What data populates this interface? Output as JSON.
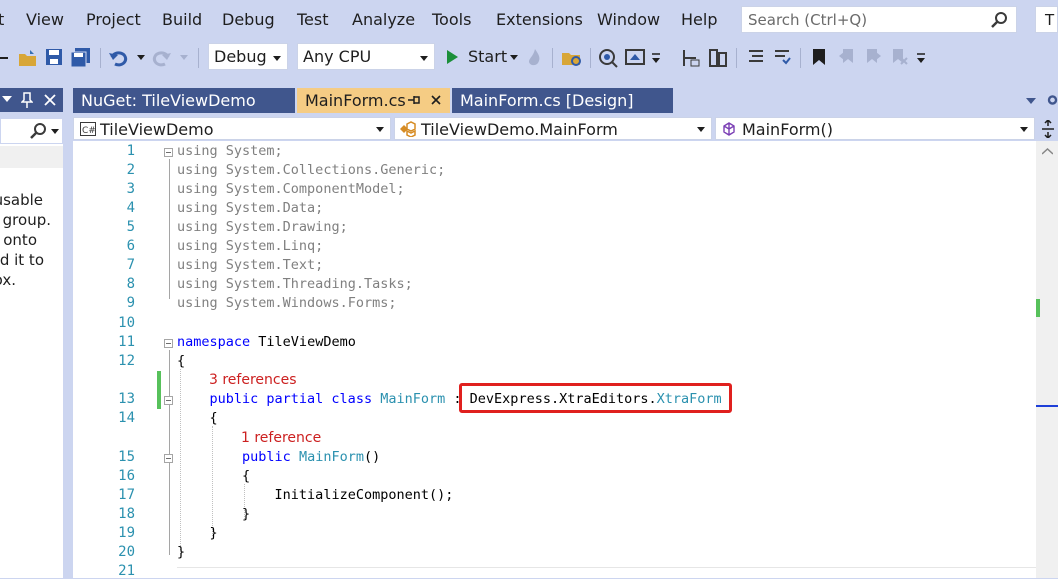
{
  "menu": {
    "partial": "t",
    "items": [
      "View",
      "Project",
      "Build",
      "Debug",
      "Test",
      "Analyze",
      "Tools",
      "Extensions",
      "Window",
      "Help"
    ]
  },
  "search": {
    "placeholder": "Search (Ctrl+Q)",
    "account_initial": "T"
  },
  "toolbar": {
    "configuration": "Debug",
    "platform": "Any CPU",
    "start_label": "Start"
  },
  "tabs": [
    {
      "label": "NuGet: TileViewDemo",
      "active": false
    },
    {
      "label": "MainForm.cs",
      "active": true
    },
    {
      "label": "MainForm.cs [Design]",
      "active": false
    }
  ],
  "nav": {
    "project": "TileViewDemo",
    "class": "TileViewDemo.MainForm",
    "member": "MainForm()"
  },
  "left_panel": {
    "lines": [
      "usable",
      "group.",
      "onto",
      "d it to",
      "ox."
    ]
  },
  "code": {
    "line_numbers": [
      "1",
      "2",
      "3",
      "4",
      "5",
      "6",
      "7",
      "8",
      "9",
      "10",
      "11",
      "12",
      "13",
      "14",
      "15",
      "16",
      "17",
      "18",
      "19",
      "20",
      "21"
    ],
    "using_kw": "using",
    "usings": [
      "System;",
      "System.Collections.Generic;",
      "System.ComponentModel;",
      "System.Data;",
      "System.Drawing;",
      "System.Linq;",
      "System.Text;",
      "System.Threading.Tasks;",
      "System.Windows.Forms;"
    ],
    "namespace_kw": "namespace",
    "namespace_name": "TileViewDemo",
    "open_brace": "{",
    "close_brace": "}",
    "class_refs": "3 references",
    "class_modifiers": "public partial class",
    "class_name": "MainForm",
    "colon": ":",
    "base_prefix": "DevExpress.XtraEditors.",
    "base_type": "XtraForm",
    "ctor_refs": "1 reference",
    "ctor_kw": "public",
    "ctor_name": "MainForm",
    "ctor_parens": "()",
    "init_call": "InitializeComponent();"
  },
  "colors": {
    "keyword": "#0000ff",
    "type": "#2b91af",
    "highlight_box": "#e0201e",
    "tab_active": "#f5cc84",
    "tab_inactive": "#40568d"
  }
}
